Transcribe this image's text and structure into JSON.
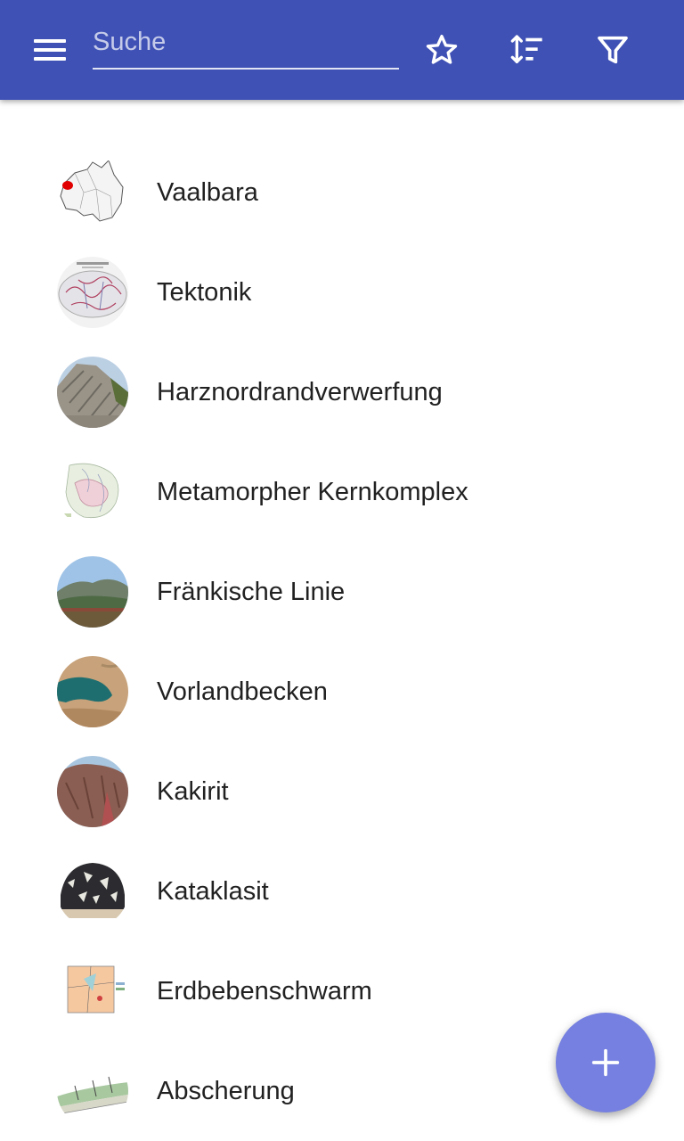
{
  "header": {
    "menu_icon": "hamburger-menu-icon",
    "search": {
      "placeholder": "Suche",
      "value": ""
    },
    "actions": [
      {
        "icon": "star-outline-icon",
        "name": "favorites-button"
      },
      {
        "icon": "sort-icon",
        "name": "sort-button"
      },
      {
        "icon": "filter-icon",
        "name": "filter-button"
      }
    ],
    "colors": {
      "primary": "#3f51b5",
      "fab": "#7580e0"
    }
  },
  "list": {
    "items": [
      {
        "label": "Vaalbara",
        "thumbnail": "australia-map-thumbnail"
      },
      {
        "label": "Tektonik",
        "thumbnail": "world-tectonic-map-thumbnail"
      },
      {
        "label": "Harznordrandverwerfung",
        "thumbnail": "rock-outcrop-photo-thumbnail"
      },
      {
        "label": "Metamorpher Kernkomplex",
        "thumbnail": "geologic-map-thumbnail"
      },
      {
        "label": "Fränkische Linie",
        "thumbnail": "landscape-photo-thumbnail"
      },
      {
        "label": "Vorlandbecken",
        "thumbnail": "satellite-image-thumbnail"
      },
      {
        "label": "Kakirit",
        "thumbnail": "cliff-photo-thumbnail"
      },
      {
        "label": "Kataklasit",
        "thumbnail": "rock-sample-photo-thumbnail"
      },
      {
        "label": "Erdbebenschwarm",
        "thumbnail": "earthquake-diagram-thumbnail"
      },
      {
        "label": "Abscherung",
        "thumbnail": "cross-section-diagram-thumbnail"
      }
    ]
  },
  "fab": {
    "icon": "plus-icon"
  }
}
